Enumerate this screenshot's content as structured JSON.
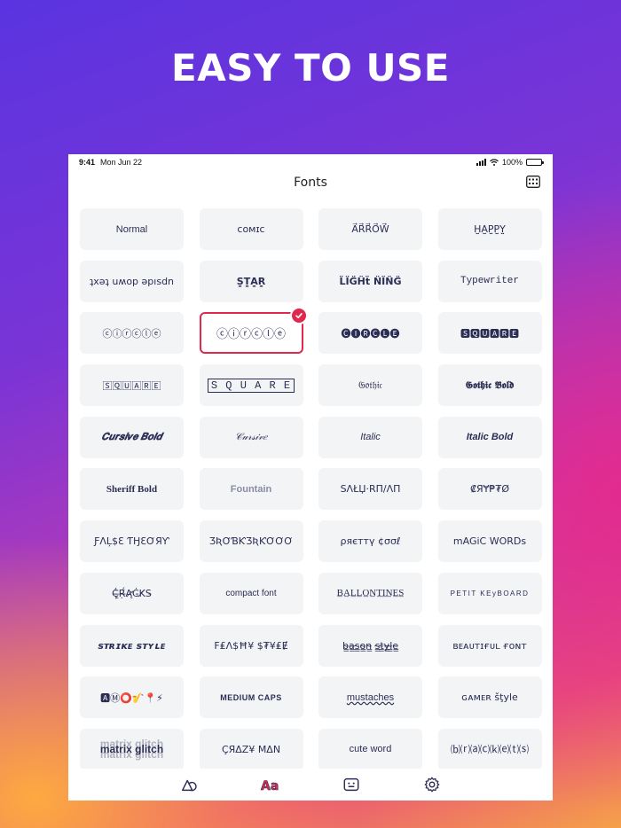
{
  "headline": "EASY TO USE",
  "status_bar": {
    "time": "9:41",
    "date": "Mon Jun 22",
    "battery": "100%"
  },
  "nav": {
    "title": "Fonts",
    "action_icon": "keyboard-grid-icon"
  },
  "colors": {
    "accent": "#e0284e",
    "tile_bg": "#f3f4f5",
    "text": "#2b2d55"
  },
  "fonts": [
    {
      "label": "Normal"
    },
    {
      "label": "ᴄᴏᴍɪᴄ"
    },
    {
      "label": "A⃗R⃗R⃗O⃗W⃗"
    },
    {
      "label": "H̤̮A̤̮P̤̮P̤̮Y̤̮"
    },
    {
      "label": "ʇxǝʇ uʍop ǝpısdn"
    },
    {
      "label": "S̤̣T̤̣A̤̣R̤̣"
    },
    {
      "label": "L̈ÏG̈Ḧẗ N̈ÏN̈G̈"
    },
    {
      "label": "Typewriter"
    },
    {
      "label": "ⓒⓘⓡⓒⓛⓔ"
    },
    {
      "label": "ⓒⓘⓡⓒⓛⓔ"
    },
    {
      "label": "🅒🅘🅡🅒🅛🅔"
    },
    {
      "label": "🆂🆀🆄🅰🆁🅴"
    },
    {
      "label": "🅂🅀🅄🄰🅁🄴"
    },
    {
      "label": "S Q U A R E"
    },
    {
      "label": "𝔊𝔬𝔱𝔥𝔦𝔠"
    },
    {
      "label": "𝕲𝖔𝖙𝖍𝖎𝖈 𝕭𝖔𝖑𝖉"
    },
    {
      "label": "𝑪𝒖𝒓𝒔𝒊𝒗𝒆 𝑩𝒐𝒍𝒅"
    },
    {
      "label": "𝒞𝓊𝓇𝓈𝒾𝓋𝑒"
    },
    {
      "label": "Italic"
    },
    {
      "label": "Italic Bold"
    },
    {
      "label": "Sheriff Bold"
    },
    {
      "label": "Fountain"
    },
    {
      "label": "SΛŁЏ·RΠ/ΛΠ"
    },
    {
      "label": "₡ЯɎ₱₮Ø"
    },
    {
      "label": "ƑΛĻ$Ɛ ƬӇƐƠЯƳ"
    },
    {
      "label": "ƷƦƠƁƘƷƦƘƠƠƠ"
    },
    {
      "label": "ρяєттү ¢σσℓ"
    },
    {
      "label": "mAGiC WORDs"
    },
    {
      "label": "Ċ̶̢̦̀Ṛ̶̈́Ą̷̛Ċ̵K̸S̵"
    },
    {
      "label": "compact font"
    },
    {
      "label": "B̲A̲L̲L̲O̲N̲T̲I̲N̲E̲S̲"
    },
    {
      "label": "PETIT KEyBOARD"
    },
    {
      "label": "ꜱᴛʀɪᴋᴇ ꜱᴛʏʟᴇ"
    },
    {
      "label": "F₤Λ$Ħ¥ $₮¥₤Ɇ"
    },
    {
      "label": "b̴̳a̴̳s̴̳o̴̳n̴̳ s̴̳t̴̳y̴̳l̴̳e̴̳"
    },
    {
      "label": "ʙᴇᴀᴜᴛɪғᴜʟ ғᴏɴᴛ"
    },
    {
      "label": "🅰Ⓜ⭕🎷📍⚡"
    },
    {
      "label": "MEDIUM CAPS"
    },
    {
      "label": "mustaches"
    },
    {
      "label": "ɢᴀᴍᴇʀ šţyle"
    },
    {
      "label": "matrix glitch"
    },
    {
      "label": "ÇЯΔZ¥ MΔN"
    },
    {
      "label": "cute word"
    },
    {
      "label": "⒝⒭⒜⒞⒦⒠⒯⒮"
    }
  ],
  "selected_index": 9,
  "tabs": [
    {
      "name": "shapes",
      "icon": "shapes-icon"
    },
    {
      "name": "fonts",
      "icon": "fonts-aa-icon"
    },
    {
      "name": "keyboard",
      "icon": "keyboard-face-icon"
    },
    {
      "name": "settings",
      "icon": "gear-icon"
    }
  ]
}
